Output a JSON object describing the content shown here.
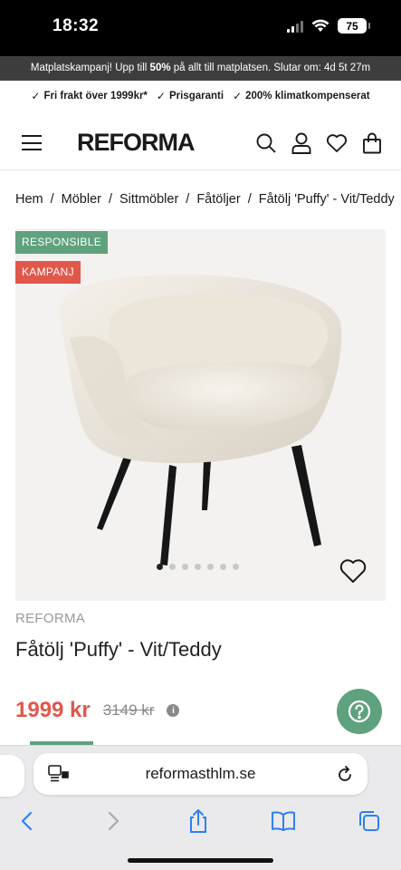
{
  "status_bar": {
    "time": "18:32",
    "battery": "75"
  },
  "promo": {
    "text_before": "Matplatskampanj! Upp till ",
    "text_bold": "50%",
    "text_after": " på allt till matplatsen. Slutar om: 4d 5t 27m"
  },
  "usps": [
    "Fri frakt över 1999kr*",
    "Prisgaranti",
    "200% klimatkompenserat"
  ],
  "header": {
    "logo": "REFORMA"
  },
  "breadcrumb": [
    "Hem",
    "Möbler",
    "Sittmöbler",
    "Fåtöljer",
    "Fåtölj 'Puffy' - Vit/Teddy"
  ],
  "product": {
    "badges": [
      "RESPONSIBLE",
      "KAMPANJ"
    ],
    "brand": "REFORMA",
    "title": "Fåtölj 'Puffy' - Vit/Teddy",
    "price": "1999 kr",
    "old_price": "3149 kr",
    "image_count": 7,
    "active_image": 1
  },
  "browser": {
    "url": "reformasthlm.se"
  },
  "colors": {
    "sale_red": "#e2574c",
    "accent_green": "#5fa27d",
    "promo_bg": "#3d3d3d"
  }
}
